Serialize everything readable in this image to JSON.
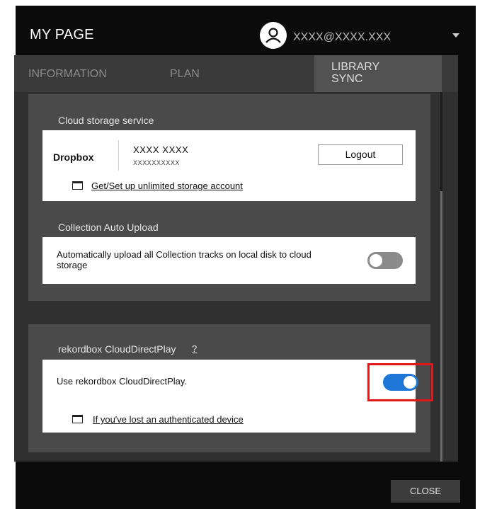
{
  "header": {
    "title": "MY PAGE",
    "user_icon": "user-icon",
    "email": "XXXX@XXXX.XXX",
    "menu_icon": "chevron-down-icon"
  },
  "tabs": [
    {
      "label": "INFORMATION",
      "active": false
    },
    {
      "label": "PLAN",
      "active": false
    },
    {
      "label": "LIBRARY\nSYNC",
      "label_lines": [
        "LIBRARY",
        "SYNC"
      ],
      "active": true
    }
  ],
  "cloud_storage": {
    "section_label": "Cloud storage service",
    "provider": "Dropbox",
    "account_name": "XXXX XXXX",
    "account_sub": "XXXXXXXXXX",
    "logout_label": "Logout",
    "storage_link": "Get/Set up unlimited storage account",
    "link_icon": "external-window-icon"
  },
  "auto_upload": {
    "section_label": "Collection Auto Upload",
    "description": "Automatically upload all Collection tracks on local disk to cloud storage",
    "toggle_on": false
  },
  "cloud_direct_play": {
    "section_label": "rekordbox CloudDirectPlay",
    "help_mark": "?",
    "option_label": "Use rekordbox CloudDirectPlay.",
    "toggle_on": true,
    "lost_device_link": "If you've lost an authenticated device",
    "link_icon": "external-window-icon"
  },
  "footer": {
    "close_label": "CLOSE"
  },
  "colors": {
    "toggle_on": "#1f78d7",
    "toggle_off": "#8a8a8a",
    "highlight": "#e31919",
    "window_bg": "#0b0b0b",
    "content_bg": "#303030",
    "card_bg": "#4a4a4a"
  }
}
